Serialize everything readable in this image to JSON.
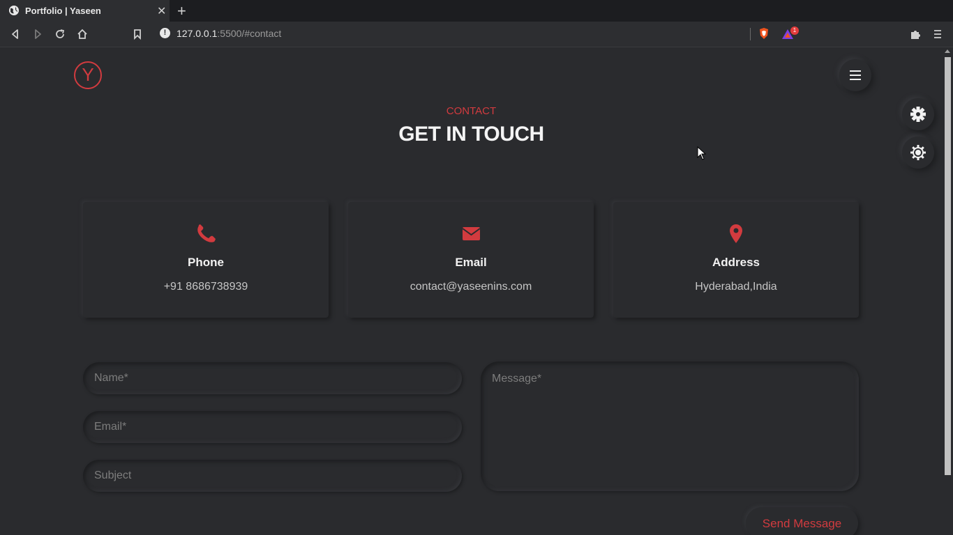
{
  "browser": {
    "tab_title": "Portfolio | Yaseen",
    "tab_close": "✕",
    "new_tab": "+",
    "url_host": "127.0.0.1",
    "url_rest": ":5500/#contact",
    "notification_count": "1",
    "icons": [
      "back-icon",
      "forward-icon",
      "reload-icon",
      "home-icon",
      "bookmark-icon",
      "info-icon",
      "brave-shield-icon",
      "brave-rewards-icon",
      "extensions-icon",
      "menu-icon"
    ]
  },
  "page": {
    "logo_letter": "Y",
    "section_subtitle": "CONTACT",
    "section_title": "GET IN TOUCH",
    "accent_color": "#d23b3f",
    "background_color": "#2a2b2e",
    "cards": [
      {
        "label": "Phone",
        "value": "+91 8686738939",
        "icon": "phone-icon"
      },
      {
        "label": "Email",
        "value": "contact@yaseenins.com",
        "icon": "envelope-icon"
      },
      {
        "label": "Address",
        "value": "Hyderabad,India",
        "icon": "map-pin-icon"
      }
    ],
    "form": {
      "name_placeholder": "Name*",
      "email_placeholder": "Email*",
      "subject_placeholder": "Subject",
      "message_placeholder": "Message*",
      "send_label": "Send Message"
    }
  }
}
